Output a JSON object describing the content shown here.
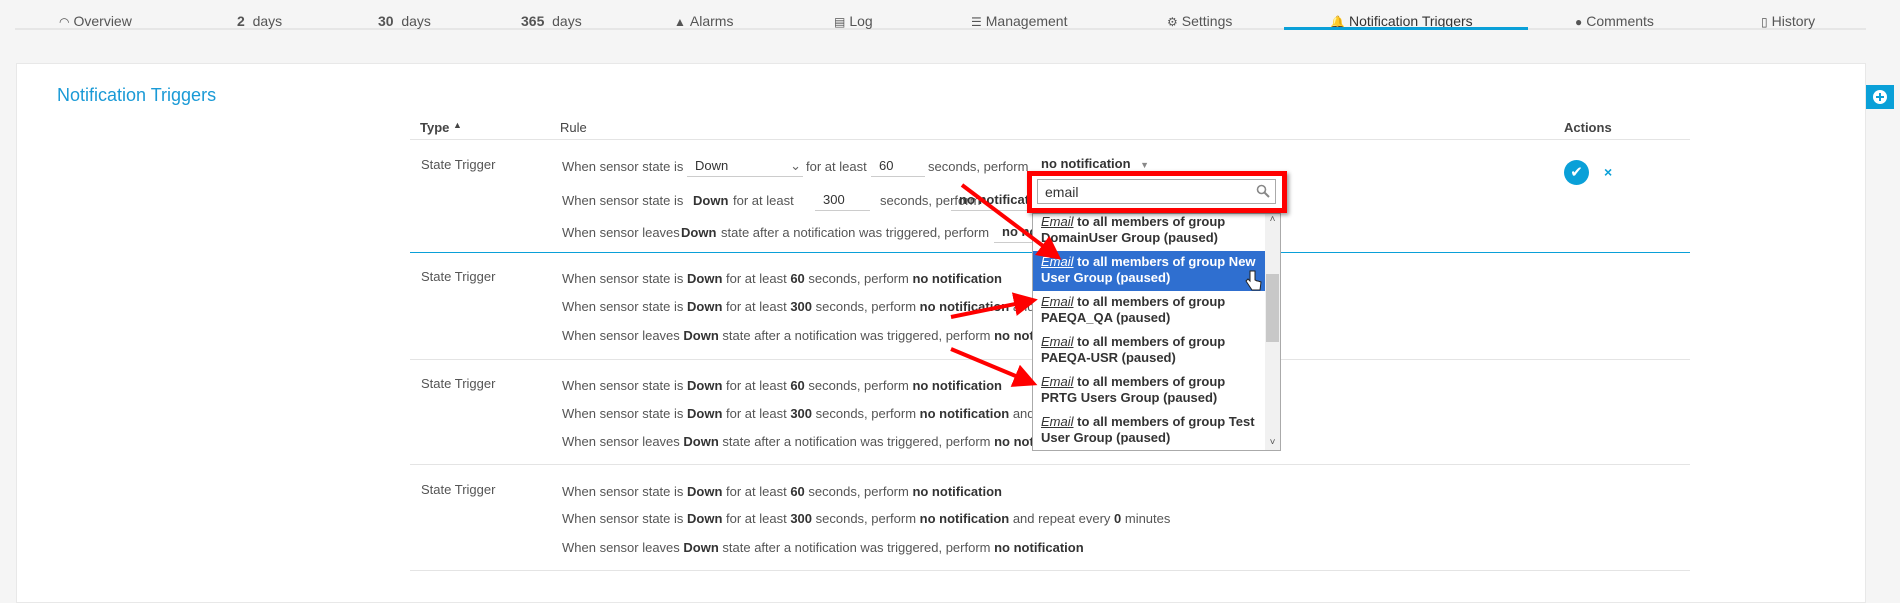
{
  "nav": {
    "tabs": [
      {
        "label": "Overview",
        "icon": "gauge-icon"
      },
      {
        "num": "2",
        "label": "days"
      },
      {
        "num": "30",
        "label": "days"
      },
      {
        "num": "365",
        "label": "days"
      },
      {
        "label": "Alarms",
        "icon": "warning-icon"
      },
      {
        "label": "Log",
        "icon": "list-icon"
      },
      {
        "label": "Management",
        "icon": "sliders-icon"
      },
      {
        "label": "Settings",
        "icon": "gear-icon"
      },
      {
        "label": "Notification Triggers",
        "icon": "bell-icon",
        "active": true
      },
      {
        "label": "Comments",
        "icon": "comment-icon"
      },
      {
        "label": "History",
        "icon": "clipboard-icon"
      }
    ]
  },
  "page": {
    "title": "Notification Triggers"
  },
  "table": {
    "headers": {
      "type": "Type",
      "rule": "Rule",
      "actions": "Actions"
    },
    "edit_row": {
      "type": "State Trigger",
      "l1a": "When sensor state is",
      "state": "Down",
      "l1b": "for at least",
      "sec1": "60",
      "l1c": "seconds, perform",
      "action1": "no notification",
      "l2a": "When sensor state is",
      "l2state": "Down",
      "l2b": "for at least",
      "sec2": "300",
      "l2c": "seconds, perform",
      "action2": "no notificati",
      "l3a": "When sensor leaves",
      "l3state": "Down",
      "l3b": "state after a notification was triggered, perform",
      "action3": "no no"
    },
    "rows": [
      {
        "type": "State Trigger",
        "l1": [
          "When sensor state is ",
          "Down",
          " for at least ",
          "60",
          " seconds, perform ",
          "no notification"
        ],
        "l2": [
          "When sensor state is ",
          "Down",
          " for at least ",
          "300",
          " seconds, perform ",
          "no notification",
          " and r"
        ],
        "l3": [
          "When sensor leaves ",
          "Down",
          " state after a notification was triggered, perform ",
          "no noti"
        ]
      },
      {
        "type": "State Trigger",
        "l1": [
          "When sensor state is ",
          "Down",
          " for at least ",
          "60",
          " seconds, perform ",
          "no notification"
        ],
        "l2": [
          "When sensor state is ",
          "Down",
          " for at least ",
          "300",
          " seconds, perform ",
          "no notification",
          " and r"
        ],
        "l3": [
          "When sensor leaves ",
          "Down",
          " state after a notification was triggered, perform ",
          "no noti"
        ]
      },
      {
        "type": "State Trigger",
        "l1": [
          "When sensor state is ",
          "Down",
          " for at least ",
          "60",
          " seconds, perform ",
          "no notification"
        ],
        "l2": [
          "When sensor state is ",
          "Down",
          " for at least ",
          "300",
          " seconds, perform ",
          "no notification",
          " and repeat every ",
          "0",
          " minutes"
        ],
        "l3": [
          "When sensor leaves ",
          "Down",
          " state after a notification was triggered, perform ",
          "no notification"
        ]
      }
    ]
  },
  "dropdown": {
    "search_value": "email",
    "items": [
      {
        "em": "Email",
        "text": " to all members of group DomainUser Group (paused)"
      },
      {
        "em": "Email",
        "text": " to all members of group New User Group (paused)",
        "highlighted": true
      },
      {
        "em": "Email",
        "text": " to all members of group PAEQA_QA (paused)"
      },
      {
        "em": "Email",
        "text": " to all members of group PAEQA-USR (paused)"
      },
      {
        "em": "Email",
        "text": " to all members of group PRTG Users Group (paused)"
      },
      {
        "em": "Email",
        "text": " to all members of group Test User Group (paused)"
      }
    ]
  },
  "colors": {
    "accent": "#0aa0d8",
    "highlight": "#2f6fd0",
    "annotation": "#ff0000"
  }
}
